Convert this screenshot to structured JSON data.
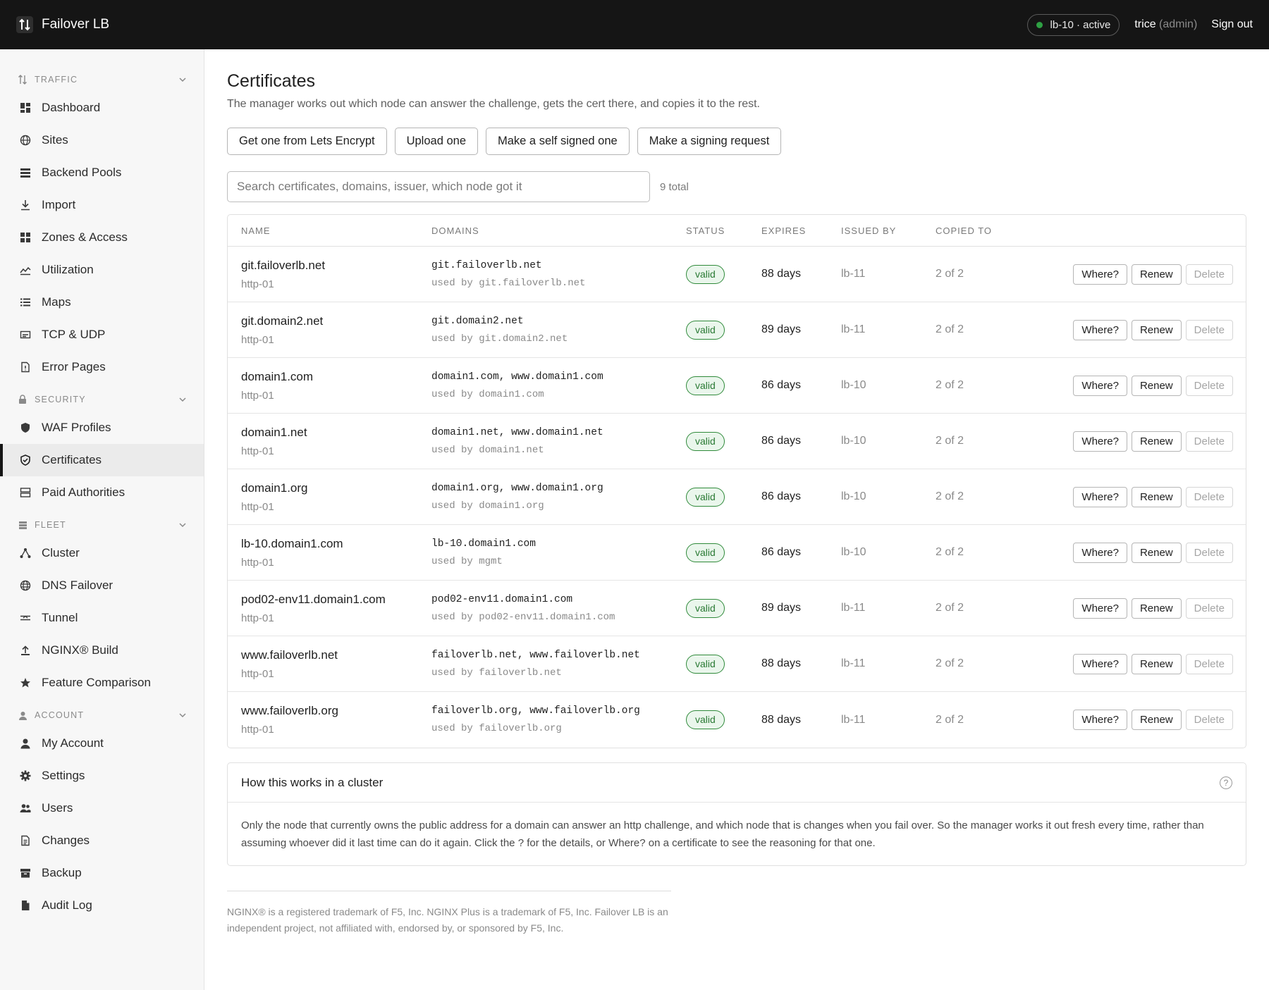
{
  "app": {
    "name": "Failover LB",
    "node_status": "lb-10 · active",
    "user": "trice",
    "role": "(admin)",
    "sign_out": "Sign out",
    "status_color": "#2ea043"
  },
  "sidebar": {
    "sections": [
      {
        "title": "TRAFFIC",
        "icon": "updown-arrows-icon",
        "items": [
          {
            "label": "Dashboard",
            "icon": "dashboard-icon"
          },
          {
            "label": "Sites",
            "icon": "globe-icon"
          },
          {
            "label": "Backend Pools",
            "icon": "stack-icon"
          },
          {
            "label": "Import",
            "icon": "download-icon"
          },
          {
            "label": "Zones & Access",
            "icon": "grid-icon"
          },
          {
            "label": "Utilization",
            "icon": "chart-icon"
          },
          {
            "label": "Maps",
            "icon": "list-icon"
          },
          {
            "label": "TCP & UDP",
            "icon": "port-icon"
          },
          {
            "label": "Error Pages",
            "icon": "file-warning-icon"
          }
        ]
      },
      {
        "title": "SECURITY",
        "icon": "lock-icon",
        "items": [
          {
            "label": "WAF Profiles",
            "icon": "shield-icon"
          },
          {
            "label": "Certificates",
            "icon": "shield-check-icon",
            "active": true
          },
          {
            "label": "Paid Authorities",
            "icon": "server-icon"
          }
        ]
      },
      {
        "title": "FLEET",
        "icon": "rack-icon",
        "items": [
          {
            "label": "Cluster",
            "icon": "cluster-icon"
          },
          {
            "label": "DNS Failover",
            "icon": "dns-globe-icon"
          },
          {
            "label": "Tunnel",
            "icon": "tunnel-icon"
          },
          {
            "label": "NGINX® Build",
            "icon": "upload-icon"
          },
          {
            "label": "Feature Comparison",
            "icon": "star-icon"
          }
        ]
      },
      {
        "title": "ACCOUNT",
        "icon": "person-icon",
        "items": [
          {
            "label": "My Account",
            "icon": "user-icon"
          },
          {
            "label": "Settings",
            "icon": "gear-icon"
          },
          {
            "label": "Users",
            "icon": "users-icon"
          },
          {
            "label": "Changes",
            "icon": "document-icon"
          },
          {
            "label": "Backup",
            "icon": "archive-icon"
          },
          {
            "label": "Audit Log",
            "icon": "log-file-icon"
          }
        ]
      }
    ]
  },
  "page": {
    "title": "Certificates",
    "subtitle": "The manager works out which node can answer the challenge, gets the cert there, and copies it to the rest.",
    "actions": [
      "Get one from Lets Encrypt",
      "Upload one",
      "Make a self signed one",
      "Make a signing request"
    ],
    "search_placeholder": "Search certificates, domains, issuer, which node got it",
    "total": "9 total"
  },
  "table": {
    "columns": [
      "NAME",
      "DOMAINS",
      "STATUS",
      "EXPIRES",
      "ISSUED BY",
      "COPIED TO"
    ],
    "row_actions": [
      "Where?",
      "Renew",
      "Delete"
    ],
    "rows": [
      {
        "name": "git.failoverlb.net",
        "method": "http-01",
        "domains": "git.failoverlb.net",
        "used_by": "used by git.failoverlb.net",
        "status": "valid",
        "expires": "88 days",
        "issued_by": "lb-11",
        "copied_to": "2 of 2"
      },
      {
        "name": "git.domain2.net",
        "method": "http-01",
        "domains": "git.domain2.net",
        "used_by": "used by git.domain2.net",
        "status": "valid",
        "expires": "89 days",
        "issued_by": "lb-11",
        "copied_to": "2 of 2"
      },
      {
        "name": "domain1.com",
        "method": "http-01",
        "domains": "domain1.com, www.domain1.com",
        "used_by": "used by domain1.com",
        "status": "valid",
        "expires": "86 days",
        "issued_by": "lb-10",
        "copied_to": "2 of 2"
      },
      {
        "name": "domain1.net",
        "method": "http-01",
        "domains": "domain1.net, www.domain1.net",
        "used_by": "used by domain1.net",
        "status": "valid",
        "expires": "86 days",
        "issued_by": "lb-10",
        "copied_to": "2 of 2"
      },
      {
        "name": "domain1.org",
        "method": "http-01",
        "domains": "domain1.org, www.domain1.org",
        "used_by": "used by domain1.org",
        "status": "valid",
        "expires": "86 days",
        "issued_by": "lb-10",
        "copied_to": "2 of 2"
      },
      {
        "name": "lb-10.domain1.com",
        "method": "http-01",
        "domains": "lb-10.domain1.com",
        "used_by": "used by mgmt",
        "status": "valid",
        "expires": "86 days",
        "issued_by": "lb-10",
        "copied_to": "2 of 2"
      },
      {
        "name": "pod02-env11.domain1.com",
        "method": "http-01",
        "domains": "pod02-env11.domain1.com",
        "used_by": "used by pod02-env11.domain1.com",
        "status": "valid",
        "expires": "89 days",
        "issued_by": "lb-11",
        "copied_to": "2 of 2"
      },
      {
        "name": "www.failoverlb.net",
        "method": "http-01",
        "domains": "failoverlb.net, www.failoverlb.net",
        "used_by": "used by failoverlb.net",
        "status": "valid",
        "expires": "88 days",
        "issued_by": "lb-11",
        "copied_to": "2 of 2"
      },
      {
        "name": "www.failoverlb.org",
        "method": "http-01",
        "domains": "failoverlb.org, www.failoverlb.org",
        "used_by": "used by failoverlb.org",
        "status": "valid",
        "expires": "88 days",
        "issued_by": "lb-11",
        "copied_to": "2 of 2"
      }
    ]
  },
  "info": {
    "title": "How this works in a cluster",
    "help": "?",
    "body": "Only the node that currently owns the public address for a domain can answer an http challenge, and which node that is changes when you fail over. So the manager works it out fresh every time, rather than assuming whoever did it last time can do it again. Click the ? for the details, or Where? on a certificate to see the reasoning for that one."
  },
  "footer": {
    "text": "NGINX® is a registered trademark of F5, Inc. NGINX Plus is a trademark of F5, Inc. Failover LB is an independent project, not affiliated with, endorsed by, or sponsored by F5, Inc."
  }
}
